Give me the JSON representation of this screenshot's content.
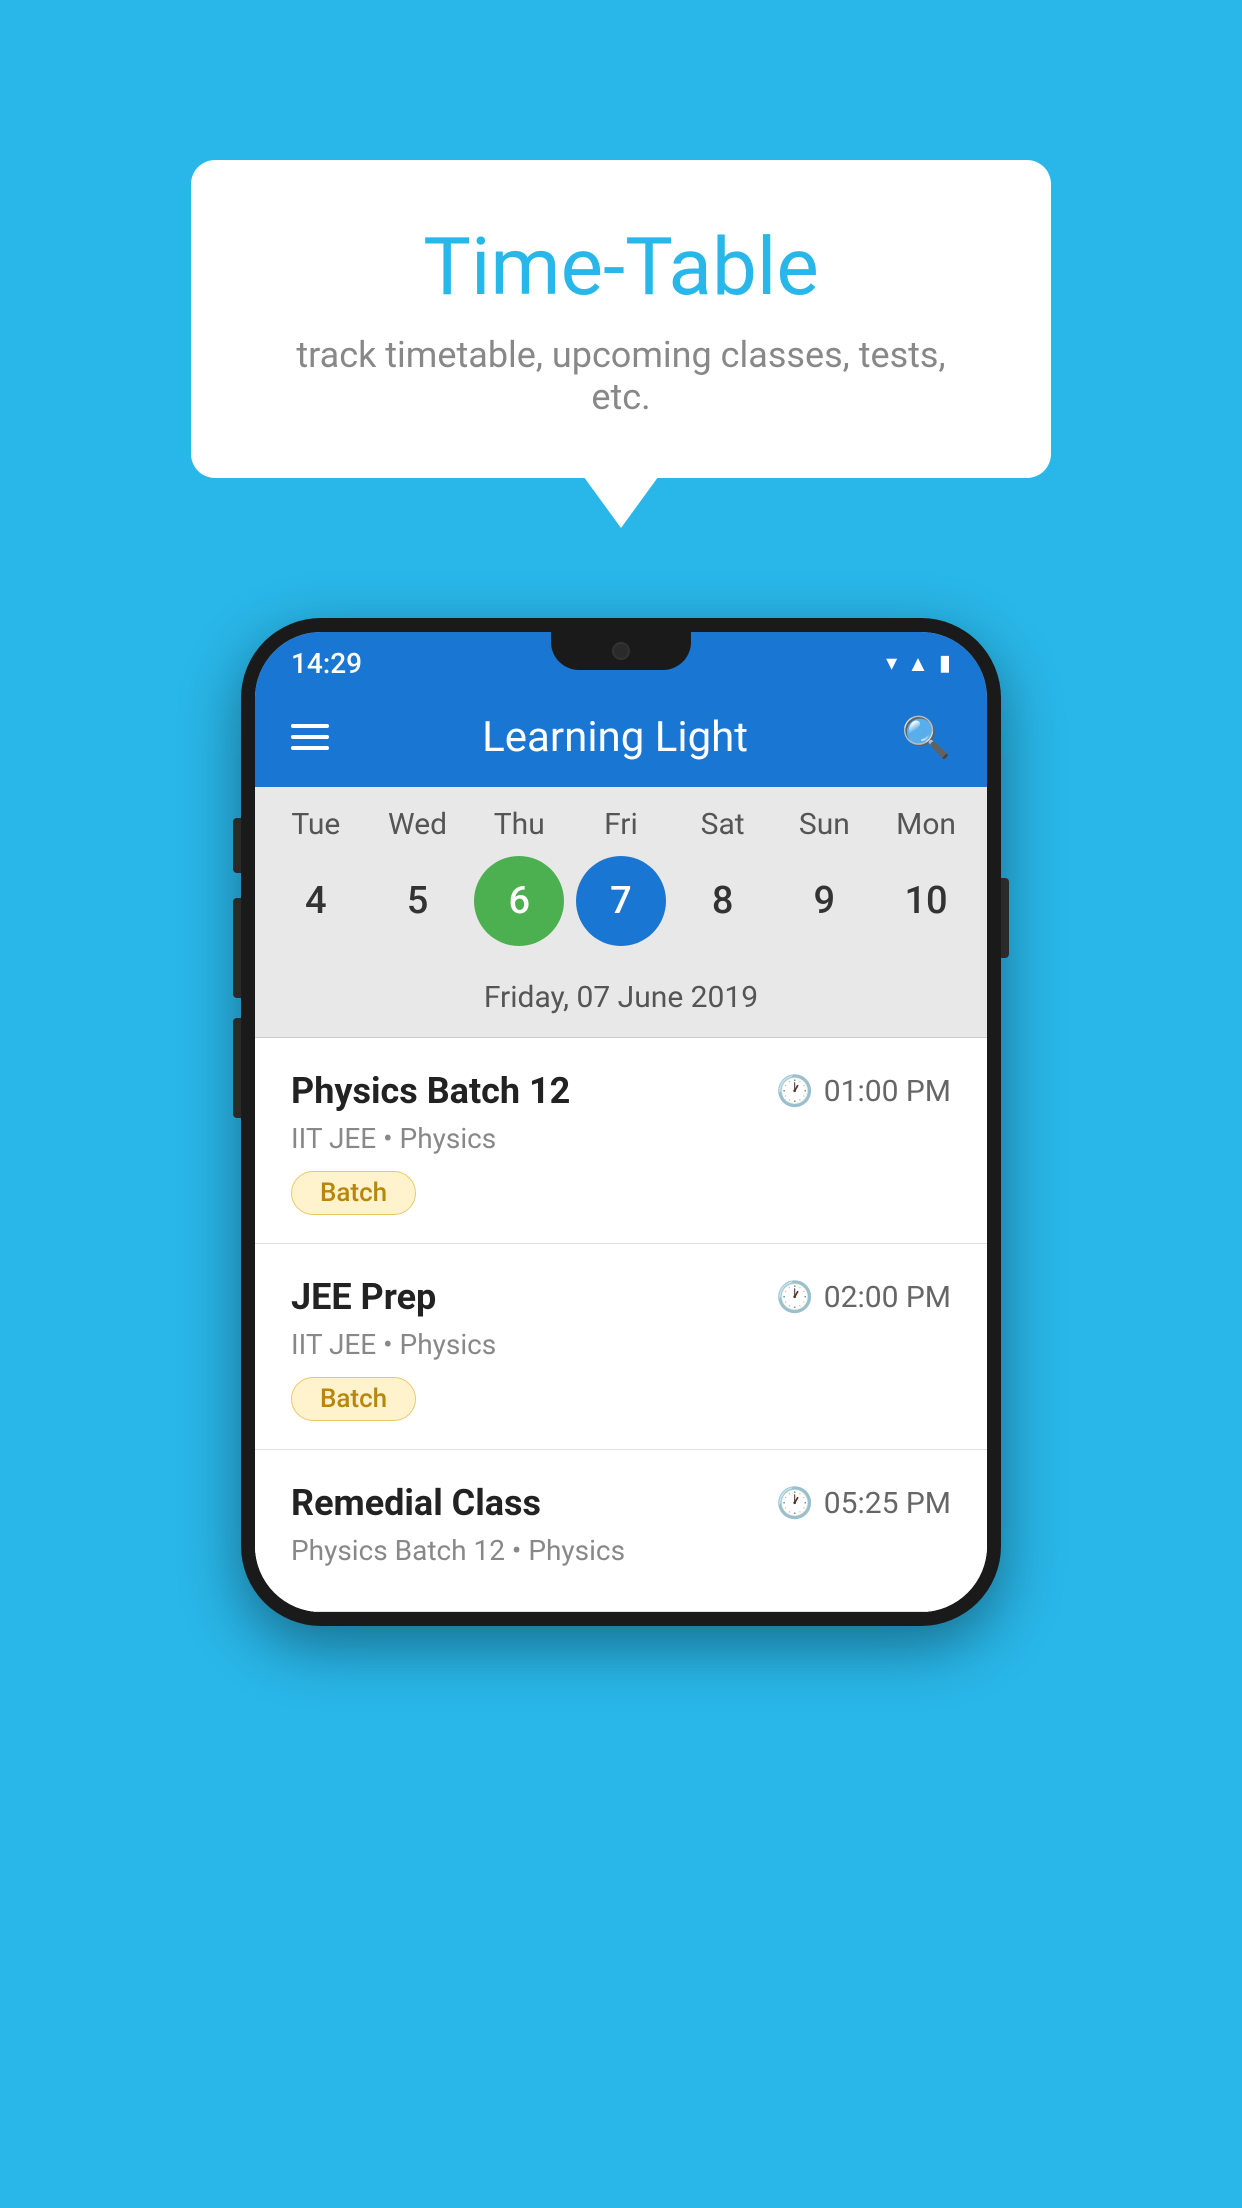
{
  "background_color": "#29B6E8",
  "bubble": {
    "title": "Time-Table",
    "subtitle": "track timetable, upcoming classes, tests, etc."
  },
  "phone": {
    "status_bar": {
      "time": "14:29"
    },
    "app_bar": {
      "title": "Learning Light"
    },
    "calendar": {
      "days": [
        "Tue",
        "Wed",
        "Thu",
        "Fri",
        "Sat",
        "Sun",
        "Mon"
      ],
      "numbers": [
        "4",
        "5",
        "6",
        "7",
        "8",
        "9",
        "10"
      ],
      "today_index": 2,
      "selected_index": 3,
      "selected_date_label": "Friday, 07 June 2019"
    },
    "schedule": [
      {
        "title": "Physics Batch 12",
        "time": "01:00 PM",
        "subtitle": "IIT JEE • Physics",
        "badge": "Batch"
      },
      {
        "title": "JEE Prep",
        "time": "02:00 PM",
        "subtitle": "IIT JEE • Physics",
        "badge": "Batch"
      },
      {
        "title": "Remedial Class",
        "time": "05:25 PM",
        "subtitle": "Physics Batch 12 • Physics",
        "badge": null
      }
    ]
  }
}
